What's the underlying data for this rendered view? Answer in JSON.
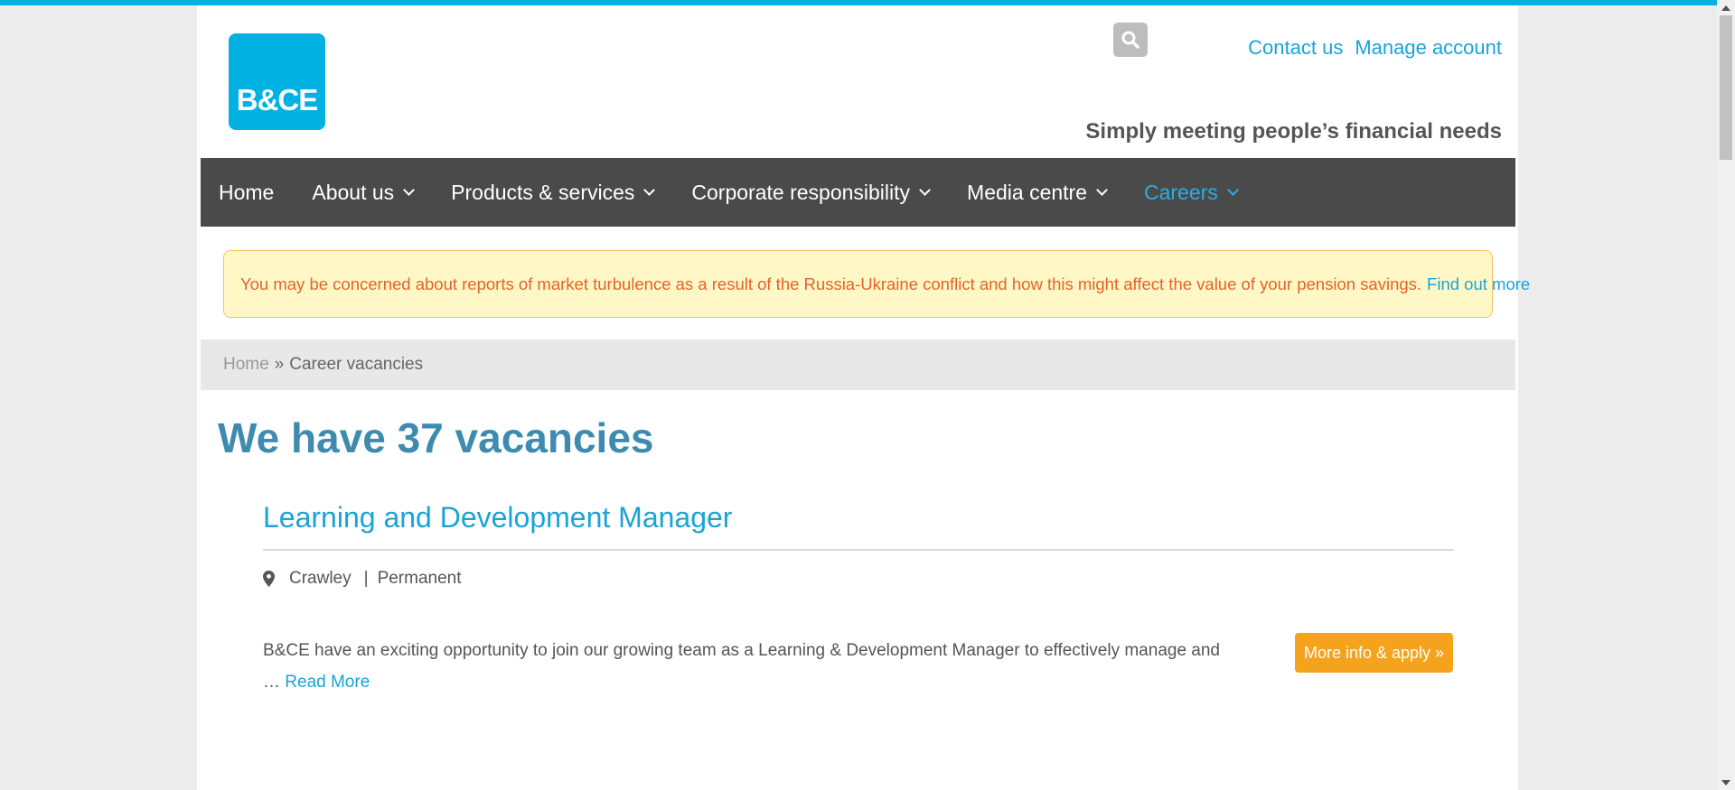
{
  "header": {
    "logo_text": "B&CE",
    "links": [
      "Contact us",
      "Manage account"
    ],
    "tagline": "Simply meeting people’s financial needs"
  },
  "nav": {
    "items": [
      {
        "label": "Home",
        "has_dropdown": false,
        "active": false
      },
      {
        "label": "About us",
        "has_dropdown": true,
        "active": false
      },
      {
        "label": "Products & services",
        "has_dropdown": true,
        "active": false
      },
      {
        "label": "Corporate responsibility",
        "has_dropdown": true,
        "active": false
      },
      {
        "label": "Media centre",
        "has_dropdown": true,
        "active": false
      },
      {
        "label": "Careers",
        "has_dropdown": true,
        "active": true
      }
    ]
  },
  "alert": {
    "message": "You may be concerned about reports of market turbulence as a result of the Russia-Ukraine conflict and how this might affect the value of your pension savings.",
    "link": "Find out more"
  },
  "breadcrumb": {
    "home": "Home",
    "separator": "»",
    "current": "Career vacancies"
  },
  "main": {
    "title": "We have 37 vacancies"
  },
  "vacancy": {
    "title": "Learning and Development Manager",
    "location": "Crawley",
    "type": "Permanent",
    "description": "B&CE have an exciting opportunity to join our growing team as a Learning & Development Manager to effectively manage and",
    "ellipsis": "…",
    "read_more": "Read More",
    "apply_label": "More info & apply »"
  },
  "colors": {
    "brand": "#00b1e1",
    "link": "#1aa3d6",
    "nav_bg": "#4a4a4a",
    "apply": "#f5a21d",
    "alert_text": "#e6622a",
    "alert_bg": "#fff8c6"
  }
}
